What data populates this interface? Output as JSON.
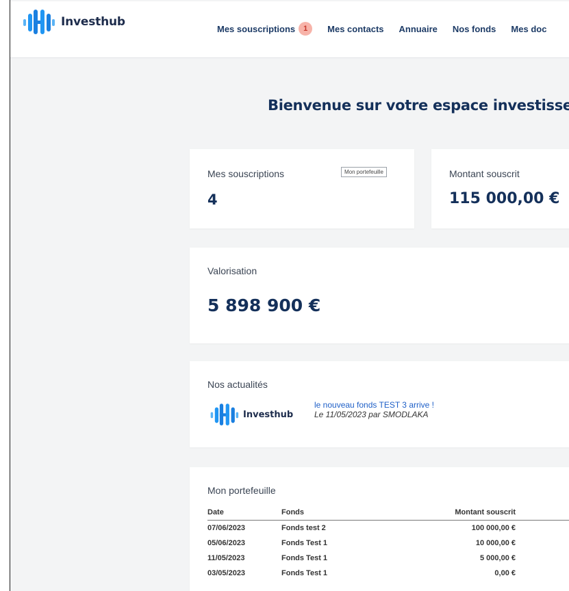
{
  "header": {
    "brand": "Investhub",
    "nav": [
      {
        "label": "Mes souscriptions",
        "badge": "1"
      },
      {
        "label": "Mes contacts"
      },
      {
        "label": "Annuaire"
      },
      {
        "label": "Nos fonds"
      },
      {
        "label": "Mes doc"
      }
    ]
  },
  "main": {
    "welcome": "Bienvenue sur votre espace investisseu",
    "cards": {
      "subscriptions": {
        "label": "Mes souscriptions",
        "value": "4",
        "link": "Mon portefeuille"
      },
      "amount": {
        "label": "Montant souscrit",
        "value": "115 000,00 €"
      },
      "valuation": {
        "label": "Valorisation",
        "value": "5 898 900 €"
      }
    },
    "news": {
      "heading": "Nos actualités",
      "logo_text": "Investhub",
      "item_title": "le nouveau fonds TEST 3 arrive !",
      "item_meta": "Le 11/05/2023 par SMODLAKA"
    },
    "portfolio": {
      "heading": "Mon portefeuille",
      "columns": [
        "Date",
        "Fonds",
        "Montant souscrit"
      ],
      "rows": [
        [
          "07/06/2023",
          "Fonds test 2",
          "100 000,00 €"
        ],
        [
          "05/06/2023",
          "Fonds Test 1",
          "10 000,00 €"
        ],
        [
          "11/05/2023",
          "Fonds Test 1",
          "5 000,00 €"
        ],
        [
          "03/05/2023",
          "Fonds Test 1",
          "0,00 €"
        ]
      ]
    }
  },
  "colors": {
    "navy": "#14305a",
    "logo_blue": "#2196f3",
    "badge_bg": "#f7b3a9"
  }
}
